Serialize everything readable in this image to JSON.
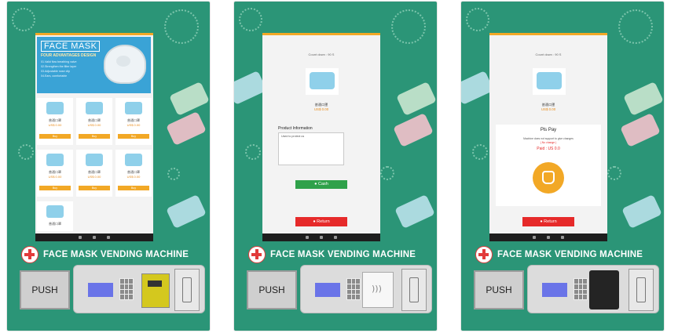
{
  "brand_color": "#2b9577",
  "machine_title": "FACE MASK VENDING MACHINE",
  "push_label": "PUSH",
  "icons": [
    "red-cross-icon",
    "home-icon",
    "back-icon",
    "recent-icon",
    "mask-icon",
    "coin-icon"
  ],
  "screen1": {
    "banner_title": "FACE MASK",
    "banner_subtitle": "FOUR ADVANTAGES DESIGN",
    "banner_lines": [
      "01.Valid flow breathing valve",
      "02.Strengthen the filter layer",
      "03.Adjustable nose clip",
      "04.Ears, comfortable"
    ],
    "products": [
      {
        "name": "普通口罩",
        "price": "US$ 0.00",
        "buy": "Buy"
      },
      {
        "name": "普通口罩",
        "price": "US$ 0.00",
        "buy": "Buy"
      },
      {
        "name": "普通口罩",
        "price": "US$ 0.00",
        "buy": "Buy"
      },
      {
        "name": "普通口罩",
        "price": "US$ 0.00",
        "buy": "Buy"
      },
      {
        "name": "普通口罩",
        "price": "US$ 0.00",
        "buy": "Buy"
      },
      {
        "name": "普通口罩",
        "price": "US$ 0.00",
        "buy": "Buy"
      },
      {
        "name": "普通口罩",
        "price": ""
      }
    ]
  },
  "screen2": {
    "header": "Count down : 90 S",
    "product_name": "普通口罩",
    "product_price": "US$ 0.00",
    "info_label": "Product Information",
    "info_text": "Used to protect us",
    "cash_button": "Cash",
    "return_button": "Return"
  },
  "screen3": {
    "header": "Count down : 90 S",
    "product_name": "普通口罩",
    "product_price": "US$ 0.00",
    "pay_title": "Pls Pay",
    "pay_note": "Machine does not support to give changes",
    "pay_change": "( No change )",
    "paid": "Paid : US 0.0",
    "return_button": "Return"
  }
}
